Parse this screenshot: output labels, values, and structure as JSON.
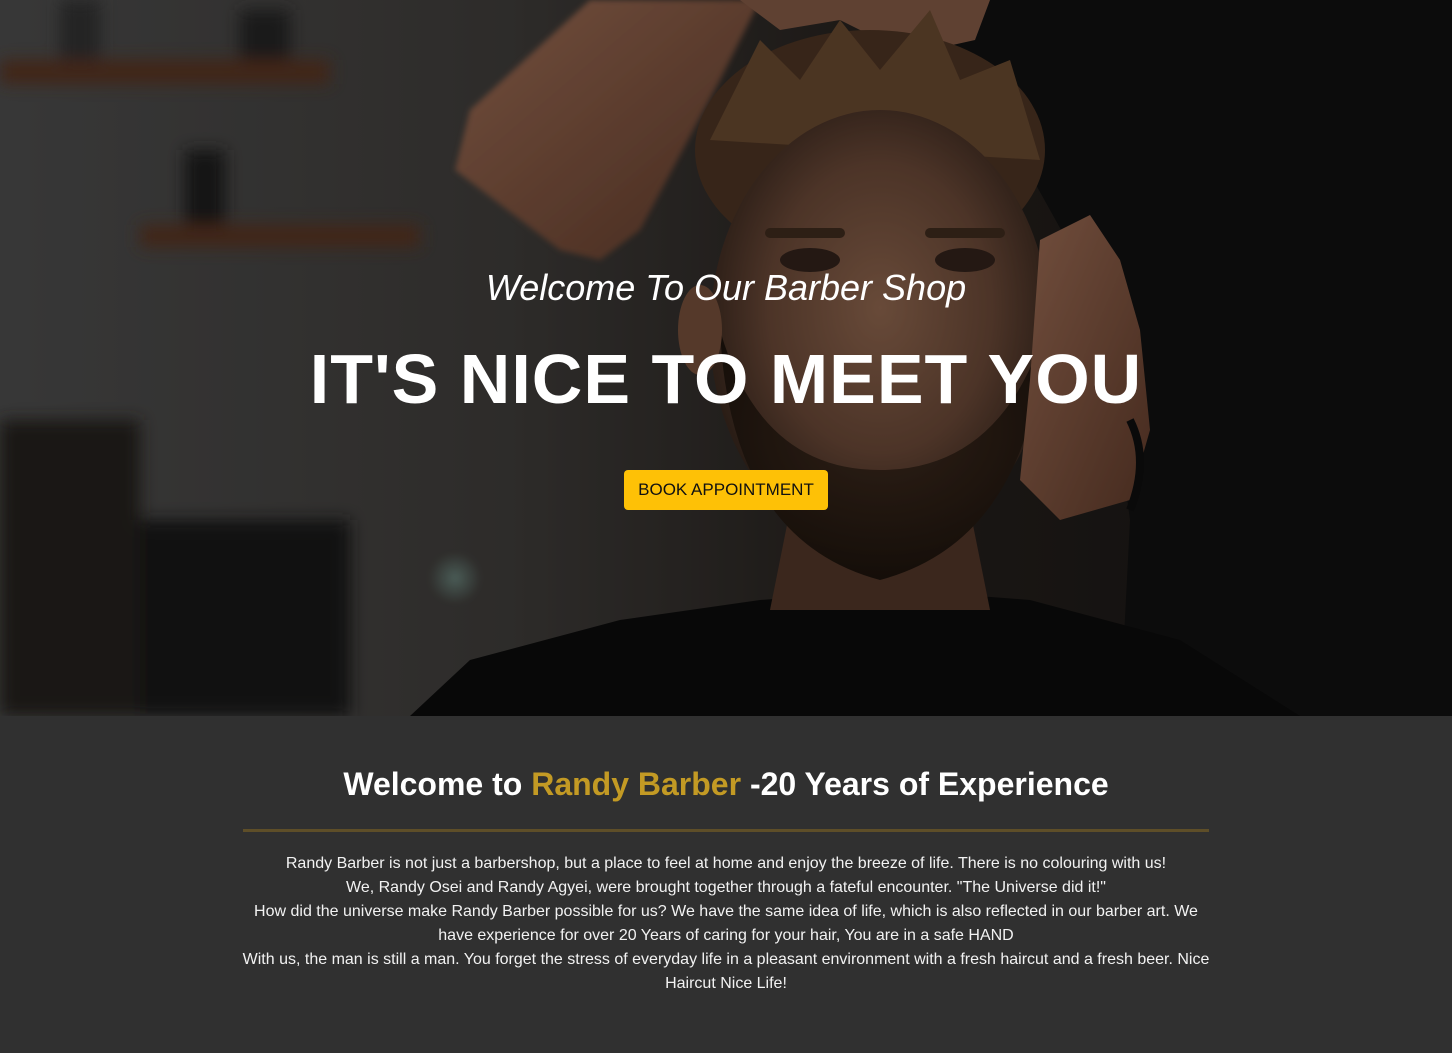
{
  "hero": {
    "subtitle": "Welcome To Our Barber Shop",
    "title": "IT'S NICE TO MEET YOU",
    "button_label": "BOOK APPOINTMENT"
  },
  "about": {
    "heading_prefix": "Welcome to",
    "heading_brand": "Randy Barber",
    "heading_suffix": "-20 Years of Experience",
    "paragraphs": [
      "Randy Barber is not just a barbershop, but a place to feel at home and enjoy the breeze of life. There is no colouring with us!",
      "We, Randy Osei and Randy Agyei, were brought together through a fateful encounter. \"The Universe did it!\"",
      "How did the universe make Randy Barber possible for us? We have the same idea of life, which is also reflected in our barber art. We have experience for over 20 Years of caring for your hair, You are in a safe HAND",
      "With us, the man is still a man. You forget the stress of everyday life in a pleasant environment with a fresh haircut and a fresh beer. Nice Haircut Nice Life!"
    ]
  },
  "colors": {
    "accent": "#fec106",
    "brand": "#c39a24",
    "background": "#303030"
  }
}
